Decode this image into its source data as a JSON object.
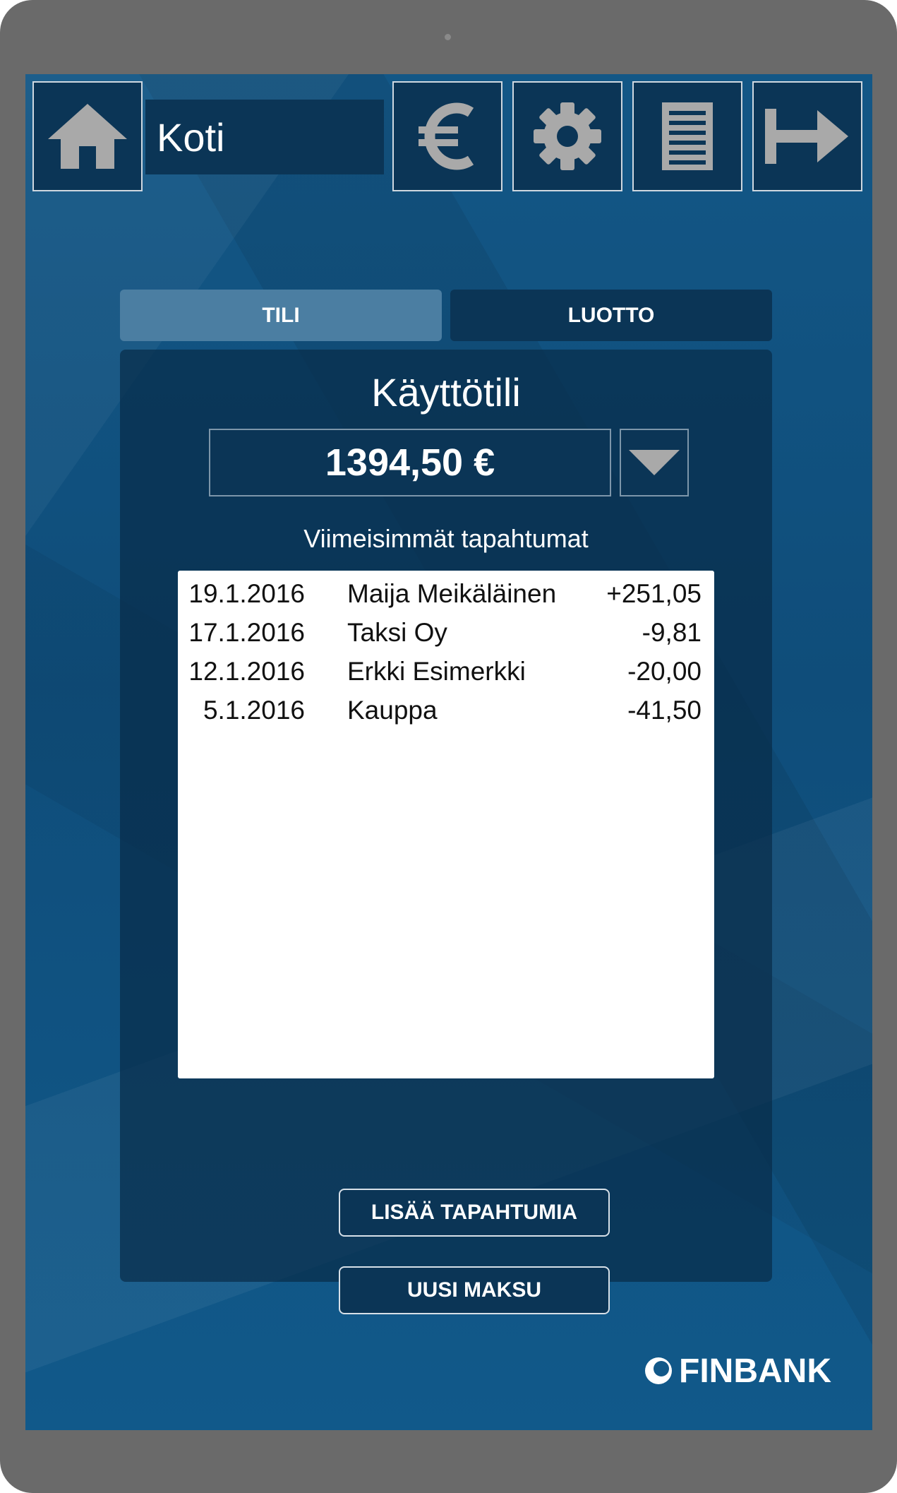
{
  "header": {
    "title": "Koti",
    "icons": [
      "home-icon",
      "euro-icon",
      "gear-icon",
      "document-icon",
      "logout-arrow-icon"
    ]
  },
  "tabs": [
    {
      "label": "TILI",
      "active": true
    },
    {
      "label": "LUOTTO",
      "active": false
    }
  ],
  "account": {
    "name": "Käyttötili",
    "balance": "1394,50 €"
  },
  "transactions": {
    "heading": "Viimeisimmät tapahtumat",
    "rows": [
      {
        "date": "19.1.2016",
        "name": "Maija Meikäläinen",
        "amount": "+251,05"
      },
      {
        "date": "17.1.2016",
        "name": "Taksi Oy",
        "amount": "-9,81"
      },
      {
        "date": "12.1.2016",
        "name": "Erkki Esimerkki",
        "amount": "-20,00"
      },
      {
        "date": "5.1.2016",
        "name": "Kauppa",
        "amount": "-41,50"
      }
    ]
  },
  "actions": {
    "more_label": "LISÄÄ TAPAHTUMIA",
    "pay_label": "UUSI MAKSU"
  },
  "brand": {
    "name": "FINBANK"
  },
  "colors": {
    "background": "#11598a",
    "button_dark": "#0b3556",
    "tab_active": "#4b7ea2",
    "icon_gray": "#a9a9a9",
    "device_frame": "#6a6a6a"
  }
}
